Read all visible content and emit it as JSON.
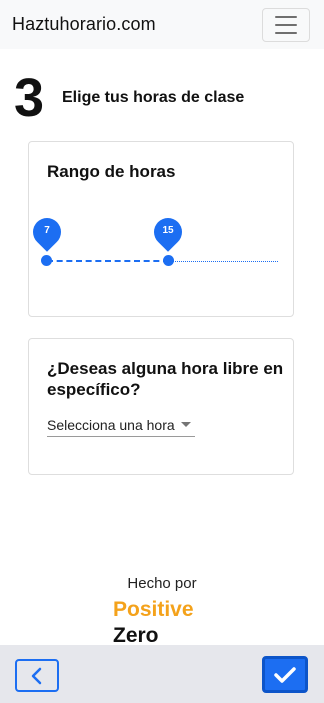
{
  "navbar": {
    "brand": "Haztuhorario.com",
    "menu_icon": "hamburger-menu-icon"
  },
  "step": {
    "number": "3",
    "title": "Elige tus horas de clase"
  },
  "range_card": {
    "title": "Rango de horas",
    "slider": {
      "min_label": "7",
      "max_label": "15",
      "start_value": 7,
      "end_value": 15
    }
  },
  "free_hour_card": {
    "title": "¿Deseas alguna hora libre en específico?",
    "select_value": "Selecciona una hora"
  },
  "footer": {
    "made_by": "Hecho por",
    "logo_line1": "Positive",
    "logo_line2": "Zero"
  },
  "bottom_bar": {
    "back_icon": "chevron-left-icon",
    "confirm_icon": "check-icon"
  },
  "colors": {
    "accent": "#1c6ef2",
    "logo_orange": "#f4a21b",
    "bottom_bar": "#e6e7ec"
  }
}
